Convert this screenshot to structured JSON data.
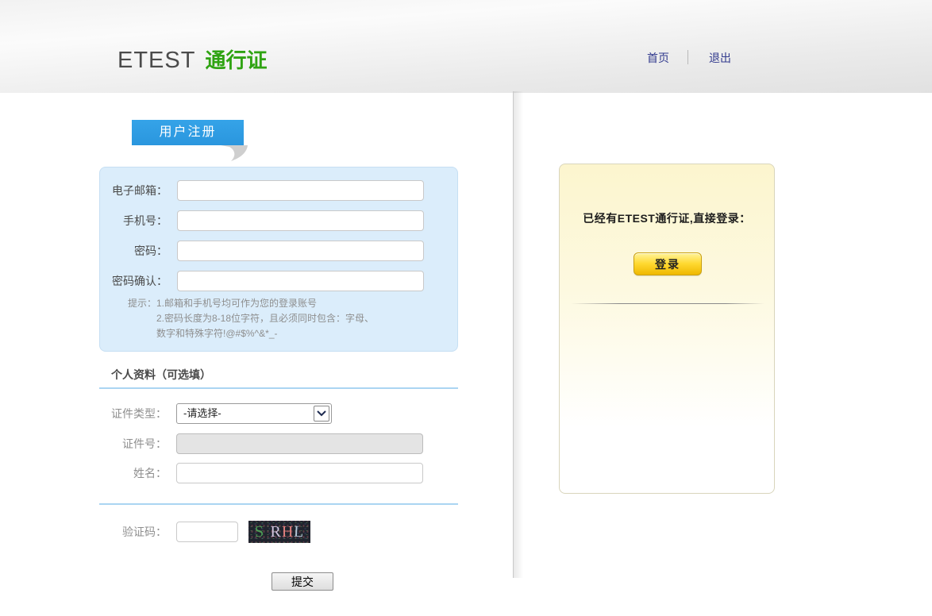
{
  "header": {
    "logo_etest": "ETEST",
    "logo_suffix": "通行证",
    "nav": {
      "home": "首页",
      "logout": "退出"
    }
  },
  "register": {
    "tab_title": "用户注册",
    "fields": {
      "email_label": "电子邮箱：",
      "mobile_label": "手机号：",
      "password_label": "密码：",
      "password_confirm_label": "密码确认："
    },
    "tips": {
      "line1": "提示：1.邮箱和手机号均可作为您的登录账号",
      "line2": "2.密码长度为8-18位字符，且必须同时包含：字母、",
      "line3": "数字和特殊字符!@#$%^&*_-"
    },
    "profile": {
      "section_title": "个人资料（可选填）",
      "id_type_label": "证件类型：",
      "id_type_value": "-请选择-",
      "id_number_label": "证件号：",
      "name_label": "姓名："
    },
    "captcha": {
      "label": "验证码：",
      "text": "S RHL",
      "letters": [
        {
          "char": "S",
          "color": "#4e9e55"
        },
        {
          "char": "R",
          "color": "#cfc3dc"
        },
        {
          "char": "H",
          "color": "#e2807e"
        },
        {
          "char": "L",
          "color": "#b7c9da"
        }
      ],
      "background": "#20242e"
    },
    "submit_label": "提交"
  },
  "login_panel": {
    "prompt": "已经有ETEST通行证,直接登录：",
    "login_button": "登录"
  },
  "colors": {
    "logo_green": "#2fa312",
    "nav_link_navy": "#333b8e",
    "tab_blue": "#2f9de4",
    "panel_bg_blue": "#dbedfb",
    "divider_light_blue": "#abd5f2",
    "login_panel_yellow": "#fcf5ce",
    "login_button_gold": "#ffd931"
  }
}
